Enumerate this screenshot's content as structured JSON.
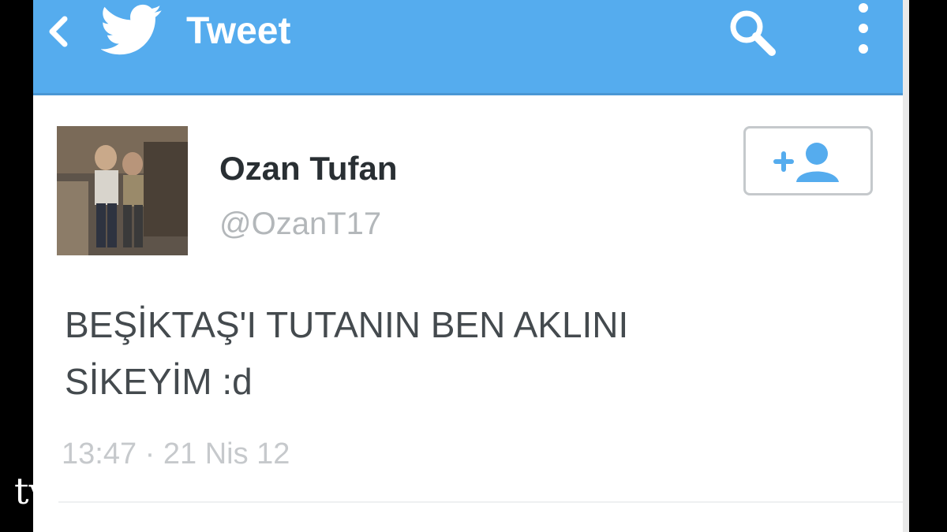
{
  "app_bar": {
    "title": "Tweet",
    "icons": [
      "back-arrow-icon",
      "twitter-bird-icon",
      "search-icon",
      "overflow-menu-icon"
    ],
    "background": "#55acee"
  },
  "tweet": {
    "author_name": "Ozan Tufan",
    "author_handle": "@OzanT17",
    "text_line1": "BEŞİKTAŞ'I TUTANIN BEN AKLINI",
    "text_line2": "SİKEYİM :d",
    "timestamp": "13:47 · 21 Nis 12",
    "follow_icon": "add-user-icon"
  },
  "watermark": "tv"
}
